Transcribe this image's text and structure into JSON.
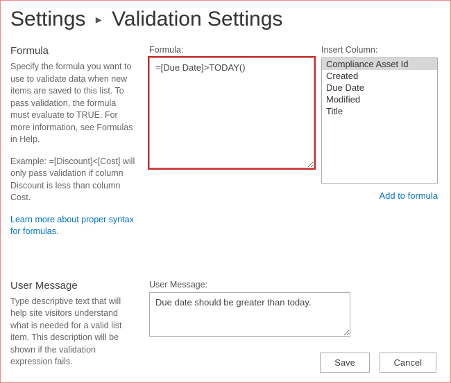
{
  "header": {
    "crumb1": "Settings",
    "crumb2": "Validation Settings"
  },
  "formulaSection": {
    "title": "Formula",
    "intro": "Specify the formula you want to use to validate data when new items are saved to this list. To pass validation, the formula must evaluate to TRUE. For more information, see Formulas in Help.",
    "example": "Example: =[Discount]<[Cost] will only pass validation if column Discount is less than column Cost.",
    "link": "Learn more about proper syntax for formulas.",
    "formulaLabel": "Formula:",
    "formulaValue": "=[Due Date]>TODAY()",
    "insertColumnLabel": "Insert Column:",
    "columns": [
      "Compliance Asset Id",
      "Created",
      "Due Date",
      "Modified",
      "Title"
    ],
    "selectedColumnIndex": 0,
    "addToFormula": "Add to formula"
  },
  "userMessageSection": {
    "title": "User Message",
    "intro": "Type descriptive text that will help site visitors understand what is needed for a valid list item. This description will be shown if the validation expression fails.",
    "label": "User Message:",
    "value": "Due date should be greater than today."
  },
  "buttons": {
    "save": "Save",
    "cancel": "Cancel"
  }
}
